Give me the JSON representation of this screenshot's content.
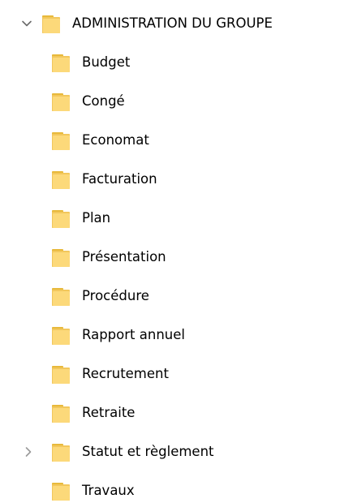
{
  "tree": {
    "root": {
      "label": "ADMINISTRATION DU GROUPE",
      "expanded": true,
      "icon": "folder-icon"
    },
    "children": [
      {
        "label": "Budget",
        "has_children": false,
        "icon": "folder-icon"
      },
      {
        "label": "Congé",
        "has_children": false,
        "icon": "folder-icon"
      },
      {
        "label": "Economat",
        "has_children": false,
        "icon": "folder-icon"
      },
      {
        "label": "Facturation",
        "has_children": false,
        "icon": "folder-icon"
      },
      {
        "label": "Plan",
        "has_children": false,
        "icon": "folder-icon"
      },
      {
        "label": "Présentation",
        "has_children": false,
        "icon": "folder-icon"
      },
      {
        "label": "Procédure",
        "has_children": false,
        "icon": "folder-icon"
      },
      {
        "label": "Rapport annuel",
        "has_children": false,
        "icon": "folder-icon"
      },
      {
        "label": "Recrutement",
        "has_children": false,
        "icon": "folder-icon"
      },
      {
        "label": "Retraite",
        "has_children": false,
        "icon": "folder-icon"
      },
      {
        "label": "Statut et règlement",
        "has_children": true,
        "expanded": false,
        "icon": "folder-icon"
      },
      {
        "label": "Travaux",
        "has_children": false,
        "icon": "folder-icon"
      }
    ]
  },
  "colors": {
    "folder_back": "#e8b93b",
    "folder_front": "#fcd97a",
    "folder_tab": "#f2c75c",
    "chevron": "#6b6b6b",
    "text": "#000000"
  }
}
